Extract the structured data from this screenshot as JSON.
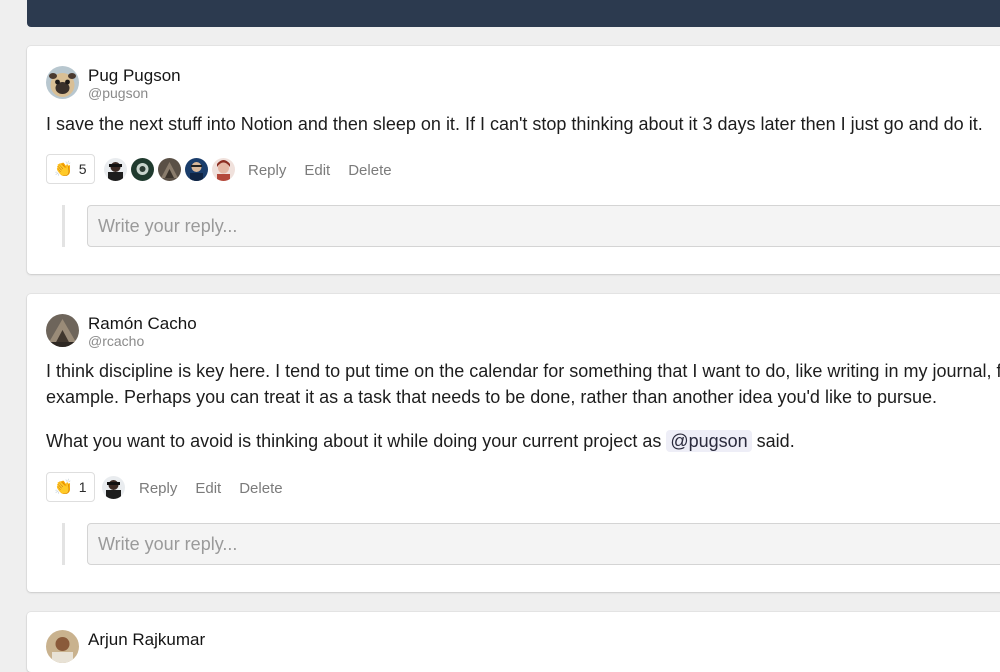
{
  "comments": [
    {
      "author": "Pug Pugson",
      "handle": "@pugson",
      "avatar_icon": "pug-avatar",
      "paragraphs": [
        "I save the next stuff into Notion and then sleep on it. If I can't stop thinking about it 3 days later then I just go and do it."
      ],
      "reaction": {
        "emoji": "👏",
        "count": "5"
      },
      "reactor_icons": [
        "reactor-avatar-1",
        "reactor-avatar-2",
        "reactor-avatar-3",
        "reactor-avatar-4",
        "reactor-avatar-5"
      ],
      "actions": {
        "reply": "Reply",
        "edit": "Edit",
        "delete": "Delete"
      },
      "reply_placeholder": "Write your reply..."
    },
    {
      "author": "Ramón Cacho",
      "handle": "@rcacho",
      "avatar_icon": "mountain-avatar",
      "paragraphs": [
        "I think discipline is key here. I tend to put time on the calendar for something that I want to do, like writing in my journal, for",
        "example. Perhaps you can treat it as a task that needs to be done, rather than another idea you'd like to pursue."
      ],
      "paragraph2": {
        "before": "What you want to avoid is thinking about it while doing your current project as ",
        "mention": "@pugson",
        "after": " said."
      },
      "reaction": {
        "emoji": "👏",
        "count": "1"
      },
      "reactor_icons": [
        "reactor-avatar-1"
      ],
      "actions": {
        "reply": "Reply",
        "edit": "Edit",
        "delete": "Delete"
      },
      "reply_placeholder": "Write your reply..."
    },
    {
      "author": "Arjun Rajkumar",
      "avatar_icon": "person-avatar"
    }
  ],
  "colors": {
    "header": "#2c3a4f",
    "background": "#efefef",
    "card": "#ffffff",
    "mention_bg": "#eeeef7"
  }
}
